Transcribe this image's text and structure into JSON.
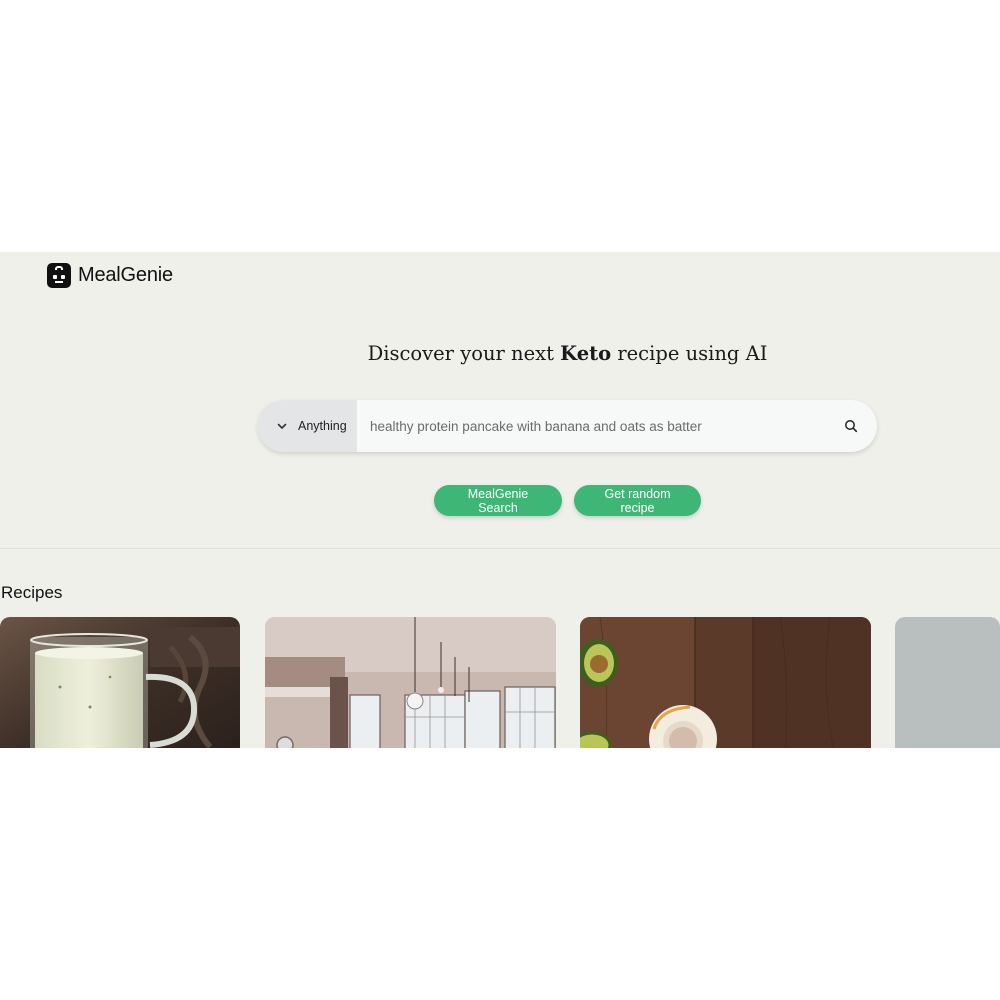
{
  "brand": {
    "name": "MealGenie",
    "icon": "chef-robot-icon"
  },
  "hero": {
    "prefix": "Discover your next ",
    "highlight": "Keto",
    "suffix": " recipe using AI"
  },
  "search": {
    "category": "Anything",
    "placeholder": "healthy protein pancake with banana and oats as batter",
    "value": "",
    "icon": "search-icon",
    "dropdown_icon": "chevron-down-icon"
  },
  "actions": {
    "search_label": "MealGenie Search",
    "random_label": "Get random recipe",
    "accent": "#3db676"
  },
  "recipes": {
    "title": "Recipes",
    "cards": [
      {
        "image": "milkshake-glass-image"
      },
      {
        "image": "kitchen-interior-image"
      },
      {
        "image": "avocado-table-image"
      },
      {
        "image": "gray-placeholder-image"
      }
    ]
  },
  "colors": {
    "background": "#eff0ea",
    "accent": "#3db676"
  }
}
